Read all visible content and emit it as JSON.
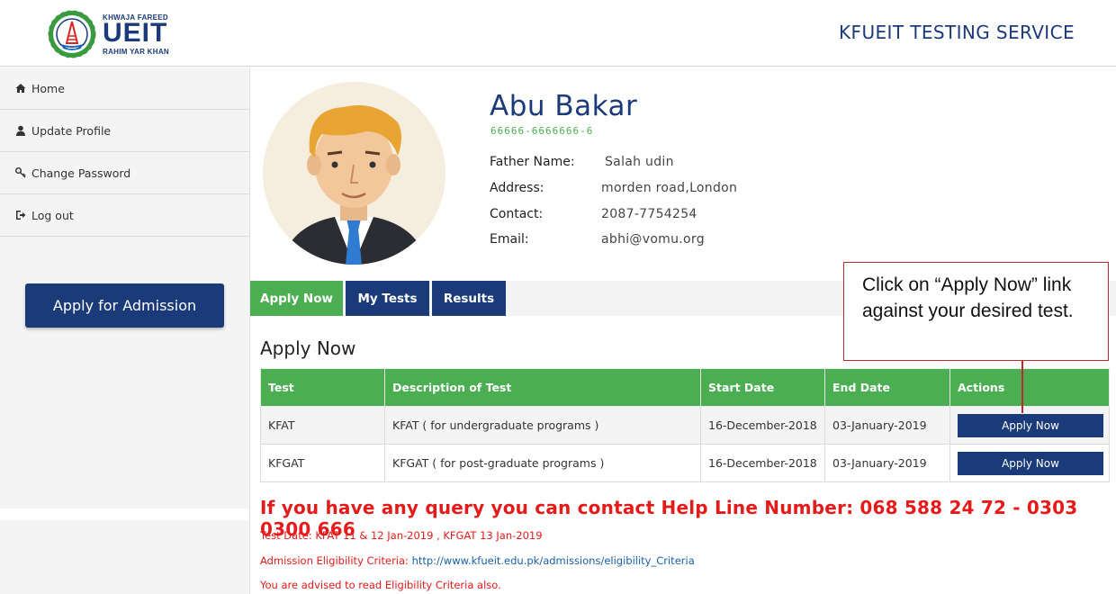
{
  "header": {
    "logo_top": "KHWAJA FAREED",
    "logo_main": "UEIT",
    "logo_bottom": "RAHIM YAR KHAN",
    "site_title": "KFUEIT TESTING SERVICE"
  },
  "sidebar": {
    "items": [
      {
        "label": "Home",
        "icon": "home-icon"
      },
      {
        "label": "Update Profile",
        "icon": "user-icon"
      },
      {
        "label": "Change Password",
        "icon": "key-icon"
      },
      {
        "label": "Log out",
        "icon": "logout-icon"
      }
    ],
    "apply_button": "Apply for Admission"
  },
  "profile": {
    "name": "Abu Bakar",
    "cnic": "66666-6666666-6",
    "father_label": "Father Name:",
    "father_value": "Salah udin",
    "address_label": "Address:",
    "address_value": "morden road,London",
    "contact_label": "Contact:",
    "contact_value": "2087-7754254",
    "email_label": "Email:",
    "email_value": "abhi@vomu.org"
  },
  "tabs": [
    "Apply Now",
    "My Tests",
    "Results"
  ],
  "section_title": "Apply Now",
  "table": {
    "headers": [
      "Test",
      "Description of Test",
      "Start Date",
      "End Date",
      "Actions"
    ],
    "rows": [
      {
        "test": "KFAT",
        "description": "KFAT ( for undergraduate programs )",
        "start": "16-December-2018",
        "end": "03-January-2019",
        "action": "Apply Now"
      },
      {
        "test": "KFGAT",
        "description": "KFGAT ( for post-graduate programs )",
        "start": "16-December-2018",
        "end": "03-January-2019",
        "action": "Apply Now"
      }
    ]
  },
  "helpline": "If you have any query you can contact Help Line Number: 068 588 24 72  - 0303 0300 666",
  "notes": {
    "test_date": "Test Date: KFAT 11 & 12 Jan-2019 , KFGAT 13 Jan-2019",
    "criteria_label": "Admission Eligibility Criteria: ",
    "criteria_link": "http://www.kfueit.edu.pk/admissions/eligibility_Criteria",
    "advice": "You are advised to read Eligibility Criteria also."
  },
  "callout": "Click on “Apply Now” link against your desired test.",
  "colors": {
    "primary_blue": "#1b3a7a",
    "green": "#4bae52",
    "red": "#e51b1b",
    "callout_border": "#c0282d"
  }
}
